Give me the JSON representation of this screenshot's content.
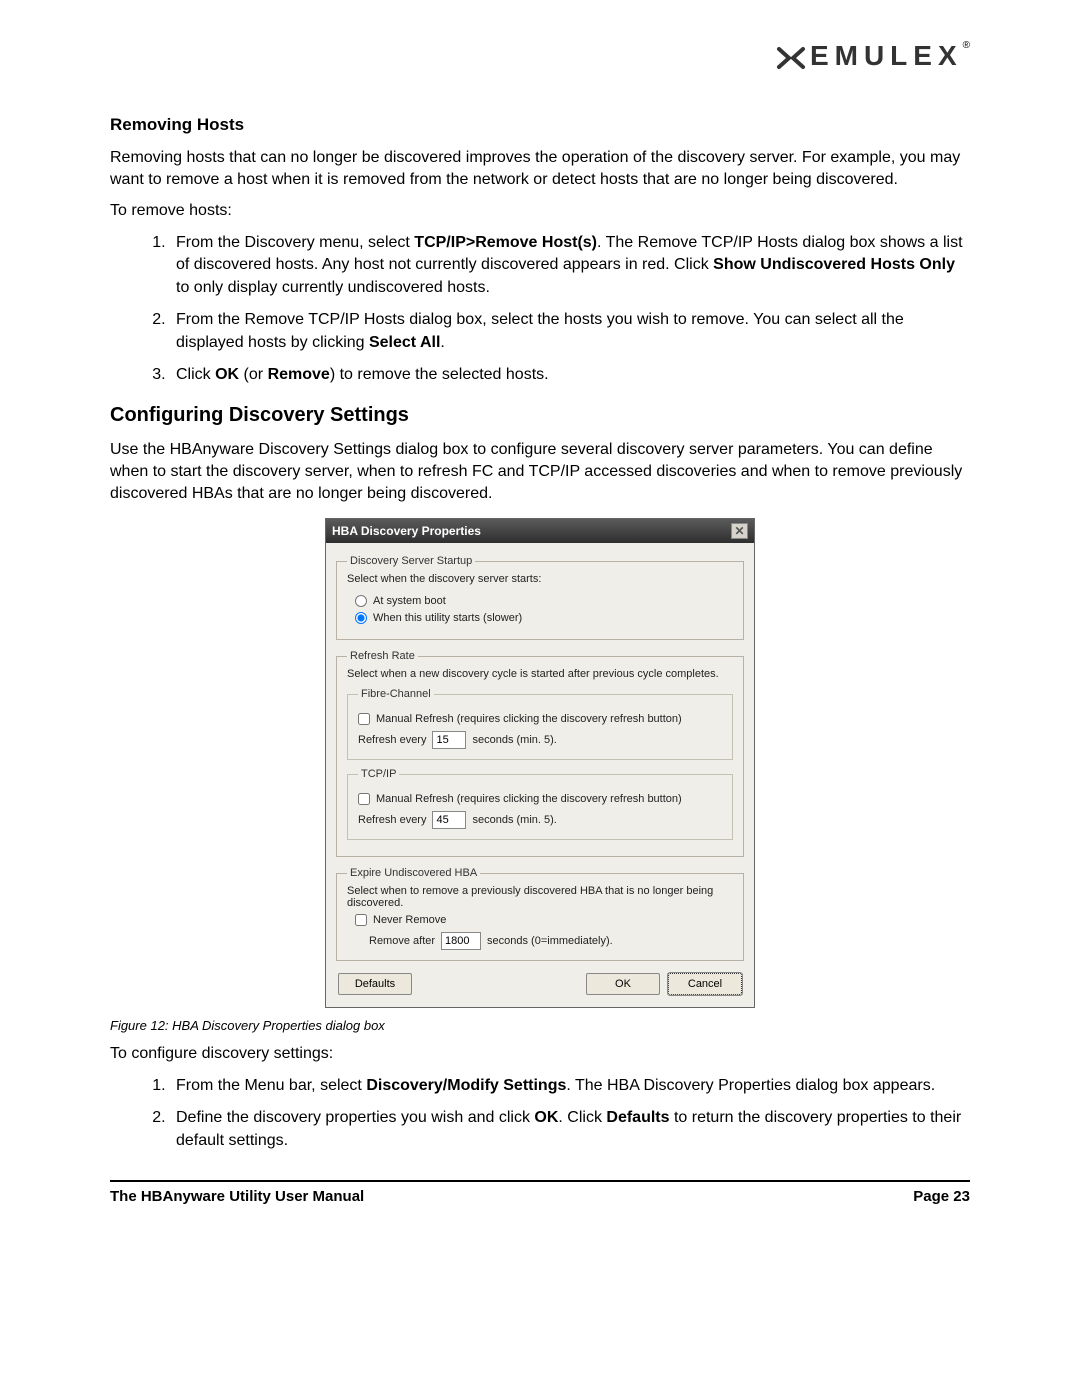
{
  "logo_text": "EMULEX",
  "section1_title": "Removing Hosts",
  "para1": "Removing hosts that can no longer be discovered improves the operation of the discovery server. For example, you may want to remove a host when it is removed from the network or detect hosts that are no longer being discovered.",
  "para2": "To remove hosts:",
  "list1": {
    "i1a": "From the Discovery menu, select ",
    "i1b": "TCP/IP>Remove Host(s)",
    "i1c": ". The Remove TCP/IP Hosts dialog box shows a list of discovered hosts. Any host not currently discovered appears in red. Click ",
    "i1d": "Show Undiscovered Hosts Only",
    "i1e": " to only display currently undiscovered hosts.",
    "i2a": "From the Remove TCP/IP Hosts dialog box, select the hosts you wish to remove. You can select all the displayed hosts by clicking ",
    "i2b": "Select All",
    "i2c": ".",
    "i3a": "Click ",
    "i3b": "OK",
    "i3c": " (or ",
    "i3d": "Remove",
    "i3e": ") to remove the selected hosts."
  },
  "section2_title": "Configuring Discovery Settings",
  "para3": "Use the HBAnyware Discovery Settings dialog box to configure several discovery server parameters. You can define when to start the discovery server, when to refresh FC and TCP/IP accessed discoveries and when to remove previously discovered HBAs that are no longer being discovered.",
  "dialog": {
    "title": "HBA Discovery Properties",
    "grp_startup": "Discovery Server Startup",
    "startup_desc": "Select when the discovery server starts:",
    "radio1": "At system boot",
    "radio2": "When this utility starts (slower)",
    "grp_refresh": "Refresh Rate",
    "refresh_desc": "Select when a new discovery cycle is started after previous cycle completes.",
    "grp_fc": "Fibre-Channel",
    "fc_check": "Manual Refresh (requires clicking the discovery refresh button)",
    "refresh_every": "Refresh every",
    "fc_value": "15",
    "seconds_min5": "seconds (min. 5).",
    "grp_tcpip": "TCP/IP",
    "tcpip_check": "Manual Refresh (requires clicking the discovery refresh button)",
    "tcpip_value": "45",
    "grp_expire": "Expire Undiscovered HBA",
    "expire_desc": "Select when to remove a previously discovered HBA that is no longer being discovered.",
    "never_remove": "Never Remove",
    "remove_after": "Remove after",
    "remove_value": "1800",
    "seconds_imm": "seconds (0=immediately).",
    "btn_defaults": "Defaults",
    "btn_ok": "OK",
    "btn_cancel": "Cancel"
  },
  "caption": "Figure 12: HBA Discovery Properties dialog box",
  "para4": "To configure discovery settings:",
  "list2": {
    "i1a": "From the Menu bar, select ",
    "i1b": "Discovery/Modify Settings",
    "i1c": ". The HBA Discovery Properties dialog box appears.",
    "i2a": "Define the discovery properties you wish and click ",
    "i2b": "OK",
    "i2c": ". Click ",
    "i2d": "Defaults",
    "i2e": " to return the discovery properties to their default settings."
  },
  "footer_left": "The HBAnyware Utility User Manual",
  "footer_right": "Page 23"
}
